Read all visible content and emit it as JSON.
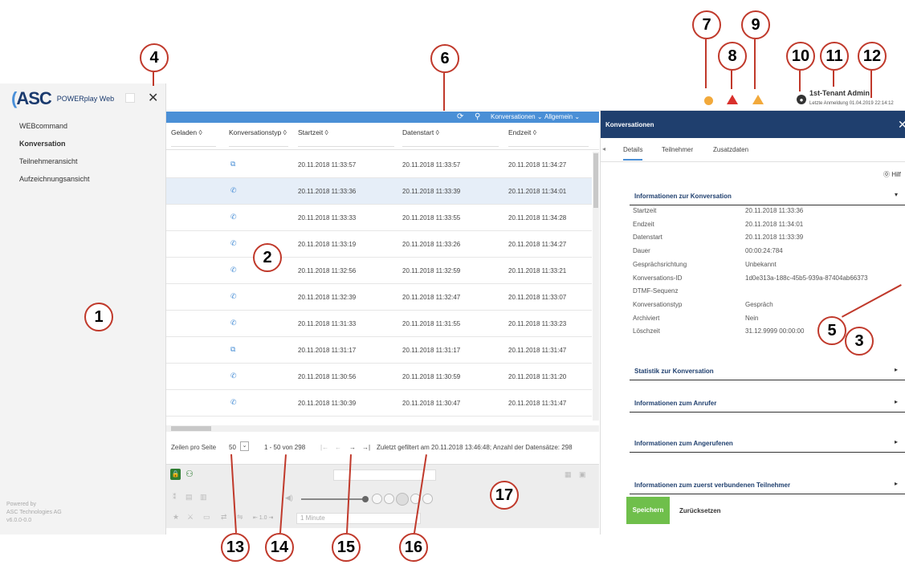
{
  "app": {
    "logo_text": "ASC",
    "product_name": "POWERplay Web",
    "close_glyph": "✕"
  },
  "sidebar": {
    "items": [
      {
        "label": "WEBcommand"
      },
      {
        "label": "Konversation"
      },
      {
        "label": "Teilnehmeransicht"
      },
      {
        "label": "Aufzeichnungsansicht"
      }
    ],
    "powered_by": "Powered by",
    "company": "ASC Technologies AG",
    "version": "v6.0.0-0.0"
  },
  "header": {
    "user_name": "1st-Tenant Admin",
    "last_login": "Letzte Anmeldung 01.04.2019 22:14:12",
    "status_colors": {
      "info": "#f2a93b",
      "error": "#d9302c",
      "warning": "#f2a93b"
    }
  },
  "grid_toolbar": {
    "menu_conversations": "Konversationen ⌄",
    "menu_general": "Allgemein ⌄"
  },
  "table": {
    "columns": [
      "Geladen ◊",
      "Konversationstyp ◊",
      "Startzeit ◊",
      "Datenstart ◊",
      "Endzeit ◊"
    ],
    "rows": [
      {
        "type_icon": "video",
        "start": "20.11.2018 11:33:57",
        "data_start": "20.11.2018 11:33:57",
        "end": "20.11.2018 11:34:27",
        "selected": false
      },
      {
        "type_icon": "phone",
        "start": "20.11.2018 11:33:36",
        "data_start": "20.11.2018 11:33:39",
        "end": "20.11.2018 11:34:01",
        "selected": true
      },
      {
        "type_icon": "phone",
        "start": "20.11.2018 11:33:33",
        "data_start": "20.11.2018 11:33:55",
        "end": "20.11.2018 11:34:28",
        "selected": false
      },
      {
        "type_icon": "phone",
        "start": "20.11.2018 11:33:19",
        "data_start": "20.11.2018 11:33:26",
        "end": "20.11.2018 11:34:27",
        "selected": false
      },
      {
        "type_icon": "phone",
        "start": "20.11.2018 11:32:56",
        "data_start": "20.11.2018 11:32:59",
        "end": "20.11.2018 11:33:21",
        "selected": false
      },
      {
        "type_icon": "phone",
        "start": "20.11.2018 11:32:39",
        "data_start": "20.11.2018 11:32:47",
        "end": "20.11.2018 11:33:07",
        "selected": false
      },
      {
        "type_icon": "phone",
        "start": "20.11.2018 11:31:33",
        "data_start": "20.11.2018 11:31:55",
        "end": "20.11.2018 11:33:23",
        "selected": false
      },
      {
        "type_icon": "video",
        "start": "20.11.2018 11:31:17",
        "data_start": "20.11.2018 11:31:17",
        "end": "20.11.2018 11:31:47",
        "selected": false
      },
      {
        "type_icon": "phone",
        "start": "20.11.2018 11:30:56",
        "data_start": "20.11.2018 11:30:59",
        "end": "20.11.2018 11:31:20",
        "selected": false
      },
      {
        "type_icon": "phone",
        "start": "20.11.2018 11:30:39",
        "data_start": "20.11.2018 11:30:47",
        "end": "20.11.2018 11:31:47",
        "selected": false
      }
    ]
  },
  "pager": {
    "rows_per_page_label": "Zeilen pro Seite",
    "rows_per_page_value": "50",
    "range": "1 - 50 von 298",
    "nav_first": "|←",
    "nav_prev": "←",
    "nav_next": "→",
    "nav_last": "→|",
    "filter_status": "Zuletzt gefiltert am 20.11.2018 13:46:48; Anzahl der Datensätze: 298"
  },
  "player": {
    "playback_rate": "⇤ 1.0 ⇥",
    "interval": "1 Minute"
  },
  "detail": {
    "title": "Konversationen",
    "tabs": [
      "Details",
      "Teilnehmer",
      "Zusatzdaten"
    ],
    "help": "⓪ Hilf",
    "section_info": "Informationen zur Konversation",
    "fields": [
      {
        "k": "Startzeit",
        "v": "20.11.2018 11:33:36"
      },
      {
        "k": "Endzeit",
        "v": "20.11.2018 11:34:01"
      },
      {
        "k": "Datenstart",
        "v": "20.11.2018 11:33:39"
      },
      {
        "k": "Dauer",
        "v": "00:00:24:784"
      },
      {
        "k": "Gesprächsrichtung",
        "v": "Unbekannt"
      },
      {
        "k": "Konversations-ID",
        "v": "1d0e313a-188c-45b5-939a-87404ab66373"
      },
      {
        "k": "DTMF-Sequenz",
        "v": ""
      },
      {
        "k": "Konversationstyp",
        "v": "Gespräch"
      },
      {
        "k": "Archiviert",
        "v": "Nein"
      },
      {
        "k": "Löschzeit",
        "v": "31.12.9999 00:00:00"
      }
    ],
    "sections_collapsed": [
      "Statistik zur Konversation",
      "Informationen zum Anrufer",
      "Informationen zum Angerufenen",
      "Informationen zum zuerst verbundenen Teilnehmer"
    ],
    "save_label": "Speichern",
    "reset_label": "Zurücksetzen"
  },
  "callouts": [
    "1",
    "2",
    "3",
    "4",
    "5",
    "6",
    "7",
    "8",
    "9",
    "10",
    "11",
    "12",
    "13",
    "14",
    "15",
    "16",
    "17"
  ]
}
